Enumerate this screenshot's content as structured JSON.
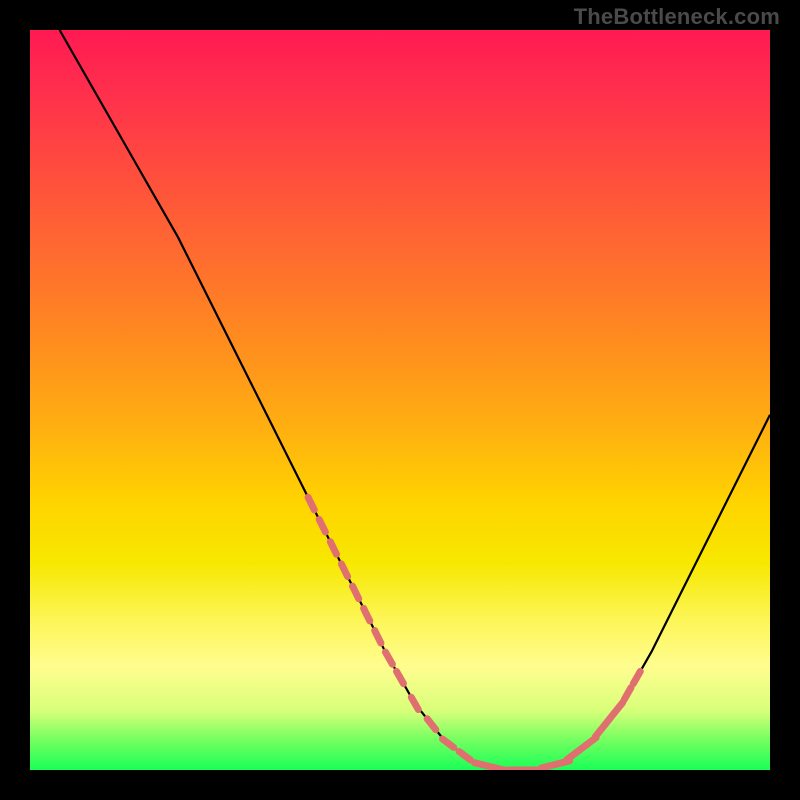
{
  "watermark": "TheBottleneck.com",
  "chart_data": {
    "type": "line",
    "title": "",
    "xlabel": "",
    "ylabel": "",
    "xlim": [
      0,
      100
    ],
    "ylim": [
      0,
      100
    ],
    "grid": false,
    "legend": false,
    "series": [
      {
        "name": "curve",
        "color": "#000000",
        "x": [
          4,
          8,
          12,
          16,
          20,
          24,
          28,
          32,
          36,
          40,
          44,
          48,
          52,
          56,
          60,
          64,
          68,
          72,
          76,
          80,
          84,
          88,
          92,
          96,
          100
        ],
        "y": [
          100,
          93,
          86,
          79,
          72,
          64,
          56,
          48,
          40,
          32,
          24,
          16,
          9,
          4,
          1,
          0,
          0,
          1,
          4,
          9,
          16,
          24,
          32,
          40,
          48
        ]
      }
    ],
    "marker_regions": [
      {
        "name": "left-descent-markers",
        "color": "#e07070",
        "x_range": [
          38,
          50
        ],
        "y_range": [
          8,
          25
        ]
      },
      {
        "name": "valley-markers",
        "color": "#e07070",
        "x_range": [
          52,
          70
        ],
        "y_range": [
          0,
          2
        ]
      },
      {
        "name": "right-ascent-markers",
        "color": "#e07070",
        "x_range": [
          72,
          82
        ],
        "y_range": [
          4,
          25
        ]
      }
    ],
    "background_gradient": {
      "direction": "vertical",
      "stops": [
        {
          "pos": 0,
          "color": "#ff1a52"
        },
        {
          "pos": 30,
          "color": "#ff6a30"
        },
        {
          "pos": 64,
          "color": "#ffd400"
        },
        {
          "pos": 86,
          "color": "#fffd8f"
        },
        {
          "pos": 100,
          "color": "#1aff58"
        }
      ]
    }
  }
}
